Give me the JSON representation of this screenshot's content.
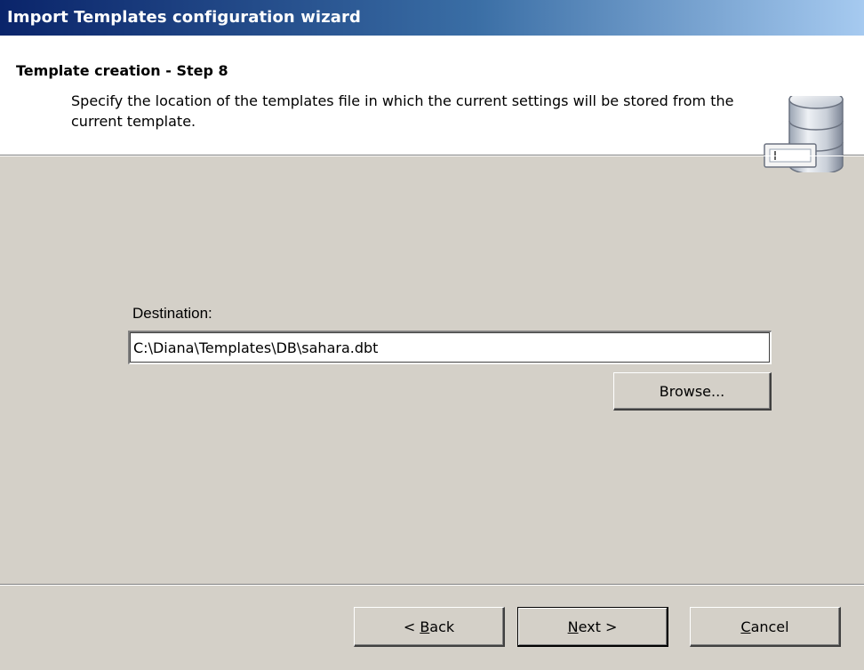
{
  "window": {
    "title": "Import Templates configuration wizard"
  },
  "header": {
    "step_title": "Template creation - Step 8",
    "description": "Specify the location of the templates file in which the current settings will be stored from the current template.",
    "icon": "database-icon"
  },
  "form": {
    "destination_label": "Destination:",
    "destination_value": "C:\\Diana\\Templates\\DB\\sahara.dbt",
    "browse_label": "Browse..."
  },
  "footer": {
    "back_prefix": "< ",
    "back_accel": "B",
    "back_rest": "ack",
    "next_accel": "N",
    "next_rest": "ext >",
    "cancel_accel": "C",
    "cancel_rest": "ancel"
  },
  "colors": {
    "title_gradient_start": "#0a246a",
    "title_gradient_end": "#a6caf0",
    "dialog_face": "#d4d0c8",
    "header_background": "#ffffff"
  }
}
